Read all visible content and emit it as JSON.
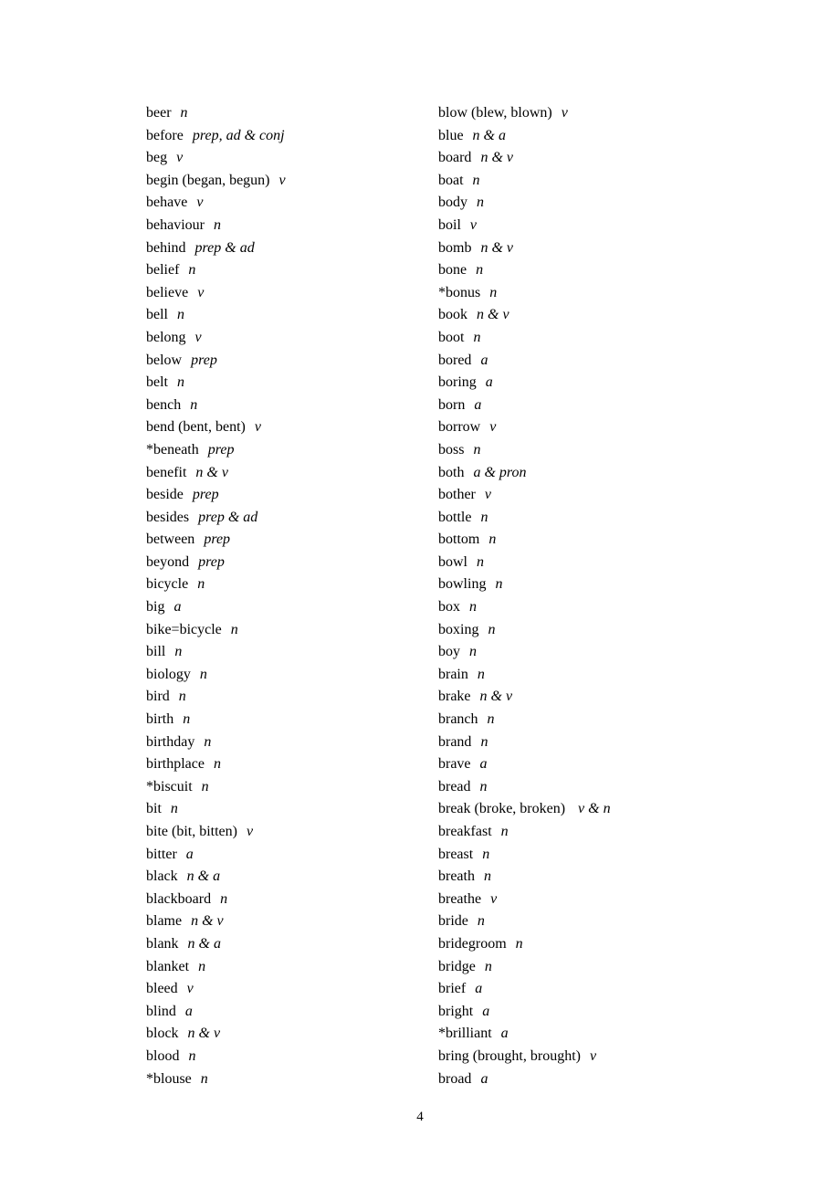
{
  "page_number": "4",
  "columns": [
    [
      {
        "word": "beer",
        "pos": "n"
      },
      {
        "word": "before",
        "pos": "prep, ad & conj"
      },
      {
        "word": "beg",
        "pos": "v"
      },
      {
        "word": "begin (began, begun)",
        "pos": "v"
      },
      {
        "word": "behave",
        "pos": "v"
      },
      {
        "word": "behaviour",
        "pos": "n"
      },
      {
        "word": "behind",
        "pos": "prep & ad"
      },
      {
        "word": "belief",
        "pos": "n"
      },
      {
        "word": "believe",
        "pos": "v"
      },
      {
        "word": "bell",
        "pos": "n"
      },
      {
        "word": "belong",
        "pos": "v"
      },
      {
        "word": "below",
        "pos": "prep"
      },
      {
        "word": "belt",
        "pos": "n"
      },
      {
        "word": "bench",
        "pos": "n"
      },
      {
        "word": "bend (bent, bent)",
        "pos": "v"
      },
      {
        "word": "*beneath",
        "pos": "prep"
      },
      {
        "word": "benefit",
        "pos": "n & v"
      },
      {
        "word": "beside",
        "pos": "prep"
      },
      {
        "word": "besides",
        "pos": "prep & ad"
      },
      {
        "word": "between",
        "pos": "prep"
      },
      {
        "word": "beyond",
        "pos": "prep"
      },
      {
        "word": "bicycle",
        "pos": "n"
      },
      {
        "word": "big",
        "pos": "a"
      },
      {
        "word": "bike=bicycle",
        "pos": "n"
      },
      {
        "word": "bill",
        "pos": "n"
      },
      {
        "word": "biology",
        "pos": "n"
      },
      {
        "word": "bird",
        "pos": "n"
      },
      {
        "word": "birth",
        "pos": "n"
      },
      {
        "word": "birthday",
        "pos": "n"
      },
      {
        "word": "birthplace",
        "pos": "n"
      },
      {
        "word": "*biscuit",
        "pos": "n"
      },
      {
        "word": "bit",
        "pos": "n"
      },
      {
        "word": "bite (bit, bitten)",
        "pos": "v"
      },
      {
        "word": "bitter",
        "pos": "a"
      },
      {
        "word": "black",
        "pos": "n & a"
      },
      {
        "word": "blackboard",
        "pos": "n"
      },
      {
        "word": "blame",
        "pos": "n & v"
      },
      {
        "word": "blank",
        "pos": "n & a"
      },
      {
        "word": "blanket",
        "pos": "n"
      },
      {
        "word": "bleed",
        "pos": "v"
      },
      {
        "word": "blind",
        "pos": "a"
      },
      {
        "word": "block",
        "pos": "n & v"
      },
      {
        "word": "blood",
        "pos": "n"
      },
      {
        "word": "*blouse",
        "pos": "n"
      }
    ],
    [
      {
        "word": "blow (blew, blown)",
        "pos": "v"
      },
      {
        "word": "blue",
        "pos": "n & a"
      },
      {
        "word": "board",
        "pos": "n & v"
      },
      {
        "word": "boat",
        "pos": "n"
      },
      {
        "word": "body",
        "pos": "n"
      },
      {
        "word": "boil",
        "pos": "v"
      },
      {
        "word": "bomb",
        "pos": "n & v"
      },
      {
        "word": "bone",
        "pos": "n"
      },
      {
        "word": "*bonus",
        "pos": "n"
      },
      {
        "word": "book",
        "pos": "n & v"
      },
      {
        "word": "boot",
        "pos": "n"
      },
      {
        "word": "bored",
        "pos": "a"
      },
      {
        "word": "boring",
        "pos": "a"
      },
      {
        "word": "born",
        "pos": "a"
      },
      {
        "word": "borrow",
        "pos": "v"
      },
      {
        "word": "boss",
        "pos": "n"
      },
      {
        "word": "both",
        "pos": "a & pron"
      },
      {
        "word": "bother",
        "pos": "v"
      },
      {
        "word": "bottle",
        "pos": "n"
      },
      {
        "word": "bottom",
        "pos": "n"
      },
      {
        "word": "bowl",
        "pos": "n"
      },
      {
        "word": "bowling",
        "pos": "n"
      },
      {
        "word": "box",
        "pos": "n"
      },
      {
        "word": "boxing",
        "pos": "n"
      },
      {
        "word": "boy",
        "pos": "n"
      },
      {
        "word": "brain",
        "pos": "n"
      },
      {
        "word": "brake",
        "pos": "n & v"
      },
      {
        "word": "branch",
        "pos": "n"
      },
      {
        "word": "brand",
        "pos": "n"
      },
      {
        "word": "brave",
        "pos": "a"
      },
      {
        "word": "bread",
        "pos": "n"
      },
      {
        "word": "break (broke, broken)   ",
        "pos": "v & n"
      },
      {
        "word": "breakfast",
        "pos": "n"
      },
      {
        "word": "breast",
        "pos": "n"
      },
      {
        "word": "breath",
        "pos": "n"
      },
      {
        "word": "breathe",
        "pos": "v"
      },
      {
        "word": "bride",
        "pos": "n"
      },
      {
        "word": "bridegroom",
        "pos": "n"
      },
      {
        "word": "bridge",
        "pos": "n"
      },
      {
        "word": "brief",
        "pos": "a"
      },
      {
        "word": "bright",
        "pos": "a"
      },
      {
        "word": "*brilliant",
        "pos": "a"
      },
      {
        "word": "bring (brought, brought)",
        "pos": "v"
      },
      {
        "word": "broad",
        "pos": "a"
      }
    ]
  ]
}
